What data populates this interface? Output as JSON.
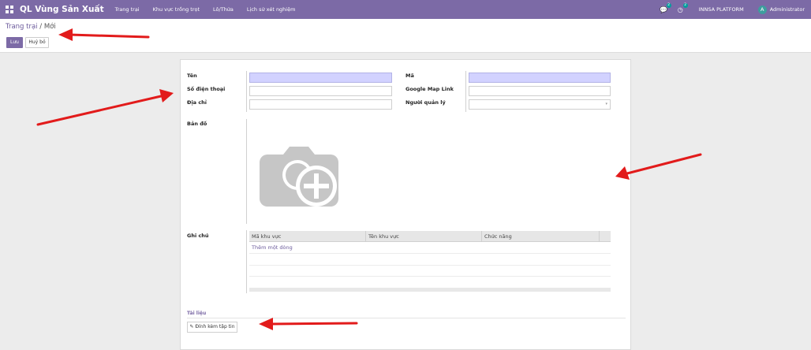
{
  "app": {
    "brand": "QL Vùng Sản Xuất",
    "menu": [
      "Trang trại",
      "Khu vực trồng trọt",
      "Lô/Thửa",
      "Lịch sử xét nghiệm"
    ],
    "chat_badge": "2",
    "activity_badge": "2",
    "company": "INNSA PLATFORM",
    "user_initial": "A",
    "user_name": "Administrator"
  },
  "breadcrumb": {
    "parent": "Trang trại",
    "separator": " / ",
    "current": "Mới"
  },
  "buttons": {
    "save": "Lưu",
    "discard": "Huỷ bỏ",
    "attach": "✎ Đính kèm tập tin"
  },
  "form": {
    "name_label": "Tên",
    "phone_label": "Số điện thoại",
    "address_label": "Địa chỉ",
    "code_label": "Mã",
    "map_link_label": "Google Map Link",
    "manager_label": "Người quản lý",
    "map_label": "Bản đồ",
    "notes_label": "Ghi chú",
    "documents_label": "Tài liệu"
  },
  "table": {
    "columns": [
      "Mã khu vực",
      "Tên khu vực",
      "Chức năng"
    ],
    "add_line": "Thêm một dòng"
  },
  "colors": {
    "accent": "#7c6aa6",
    "required_field": "#d2d2ff",
    "arrow": "#e21b1b"
  }
}
